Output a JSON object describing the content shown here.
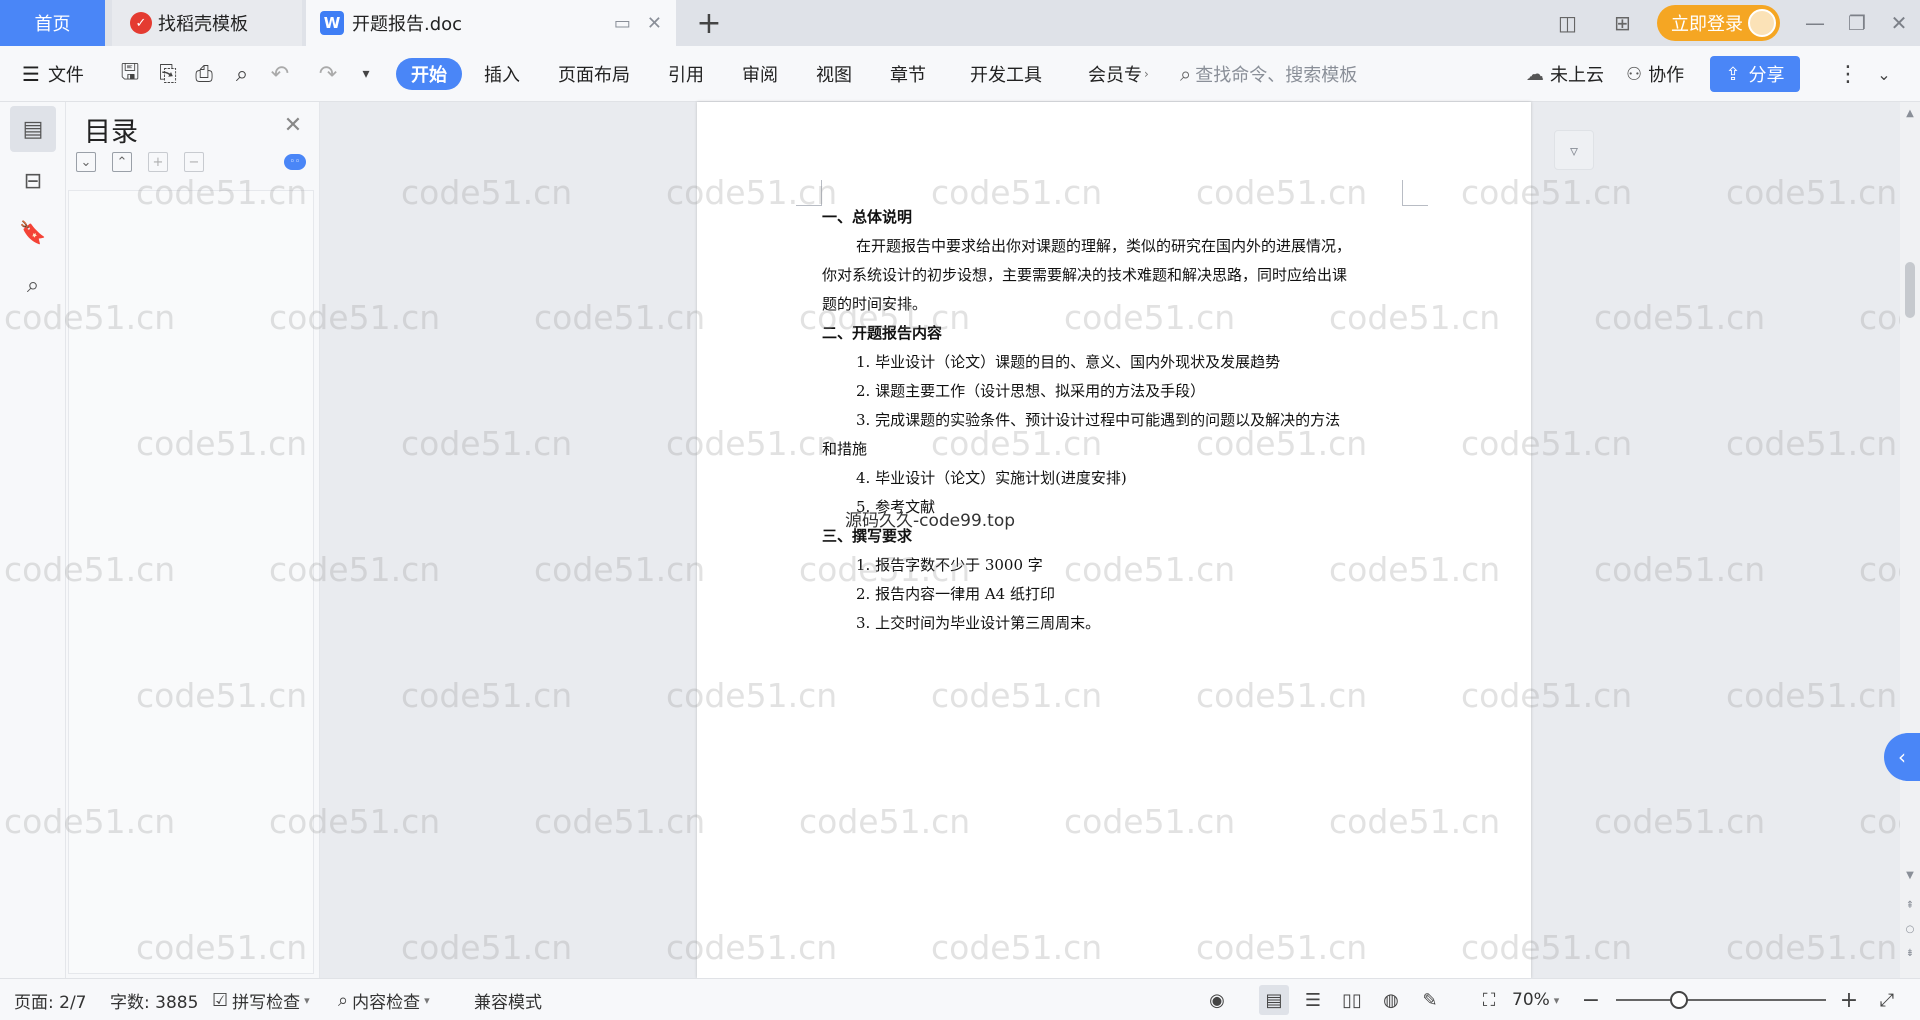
{
  "tabs": {
    "home": "首页",
    "templates": "找稻壳模板",
    "document": "开题报告.doc",
    "login": "立即登录"
  },
  "ribbon": {
    "file": "文件",
    "menus": [
      "开始",
      "插入",
      "页面布局",
      "引用",
      "审阅",
      "视图",
      "章节",
      "开发工具",
      "会员专"
    ],
    "search_placeholder": "查找命令、搜索模板",
    "cloud": "未上云",
    "collab": "协作",
    "share": "分享"
  },
  "toc": {
    "title": "目录"
  },
  "document": {
    "lines": [
      "一、总体说明",
      "在开题报告中要求给出你对课题的理解，类似的研究在国内外的进展情况，",
      "你对系统设计的初步设想，主要需要解决的技术难题和解决思路，同时应给出课",
      "题的时间安排。",
      "二、开题报告内容",
      "1. 毕业设计（论文）课题的目的、意义、国内外现状及发展趋势",
      "2. 课题主要工作（设计思想、拟采用的方法及手段）",
      "3. 完成课题的实验条件、预计设计过程中可能遇到的问题以及解决的方法",
      "和措施",
      "4. 毕业设计（论文）实施计划(进度安排)",
      "5. 参考文献",
      "三、撰写要求",
      "1. 报告字数不少于 3000 字",
      "2. 报告内容一律用 A4 纸打印",
      "3. 上交时间为毕业设计第三周周末。"
    ],
    "overlay": "源码久久-code99.top"
  },
  "watermark": "code51.cn",
  "status": {
    "page": "页面: 2/7",
    "words": "字数: 3885",
    "spell": "拼写检查",
    "content": "内容检查",
    "compat": "兼容模式",
    "zoom": "70%",
    "zoom_fraction": 0.3
  },
  "colors": {
    "accent": "#4a86f7",
    "login": "#f5a623"
  }
}
